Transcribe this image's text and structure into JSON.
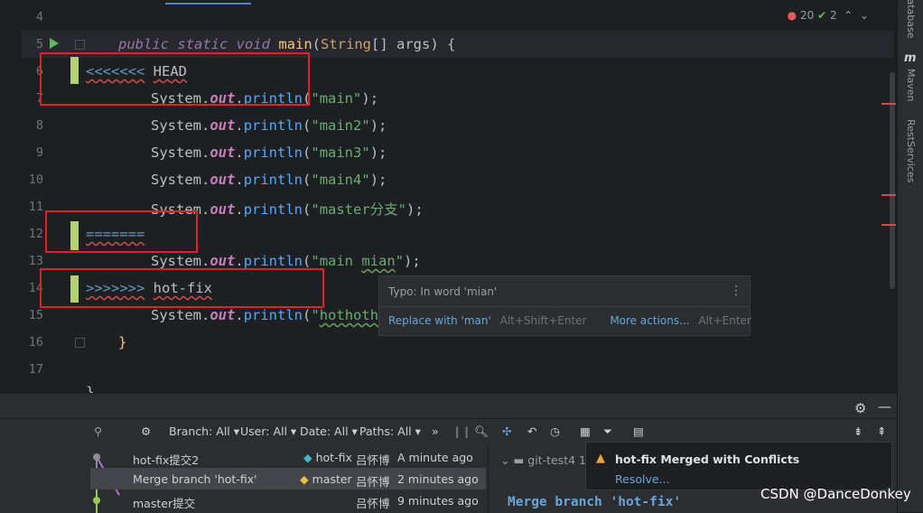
{
  "editor": {
    "line_numbers": [
      "4",
      "5",
      "6",
      "7",
      "8",
      "9",
      "10",
      "11",
      "12",
      "13",
      "14",
      "15",
      "16",
      "17"
    ],
    "code": {
      "l5_kw": "public static void",
      "l5_fn": "main",
      "l5_type": "String",
      "l5_rest": "[] args) {",
      "l6_marker": "<<<<<<<",
      "l6_ref": "HEAD",
      "system": "System",
      "out": "out",
      "println": "println",
      "s7": "\"main\"",
      "s8": "\"main2\"",
      "s9": "\"main3\"",
      "s10": "\"main4\"",
      "s11": "\"master分支\"",
      "l12_marker": "=======",
      "s13a": "\"main ",
      "s13b": "mian",
      "s13c": "\"",
      "l14_marker": ">>>>>>>",
      "l14_ref": "hot-fix",
      "s15a": "\"",
      "s15b": "hothotho",
      "l16": "}",
      "l18": "}"
    },
    "inspections": {
      "errors": "20",
      "warnings": "2"
    }
  },
  "tooltip": {
    "title": "Typo: In word 'mian'",
    "replace": "Replace with 'man'",
    "replace_shortcut": "Alt+Shift+Enter",
    "more": "More actions...",
    "more_shortcut": "Alt+Enter"
  },
  "right_tools": {
    "database": "Database",
    "maven": "Maven",
    "rest": "RestServices"
  },
  "git": {
    "filters": {
      "branch": "Branch: All",
      "user": "User: All",
      "date": "Date: All",
      "paths": "Paths: All"
    },
    "commits": [
      {
        "message": "hot-fix提交2",
        "tag": "hot-fix",
        "author": "吕怀博",
        "time": "A minute ago"
      },
      {
        "message": "Merge branch 'hot-fix'",
        "tag": "master",
        "author": "吕怀博",
        "time": "2 minutes ago"
      },
      {
        "message": "master提交",
        "tag": "",
        "author": "吕怀博",
        "time": "9 minutes ago"
      }
    ],
    "repo": "git-test4",
    "repo_count": "1",
    "detail_title": "Merge branch 'hot-fix'"
  },
  "notification": {
    "title": "hot-fix Merged with Conflicts",
    "action": "Resolve..."
  },
  "watermark": "CSDN @DanceDonkey",
  "colors": {
    "editor_bg": "#1e1f22",
    "conflict_red": "#e0212b",
    "change_marker": "#b3d46c",
    "link": "#6aa7d9"
  }
}
